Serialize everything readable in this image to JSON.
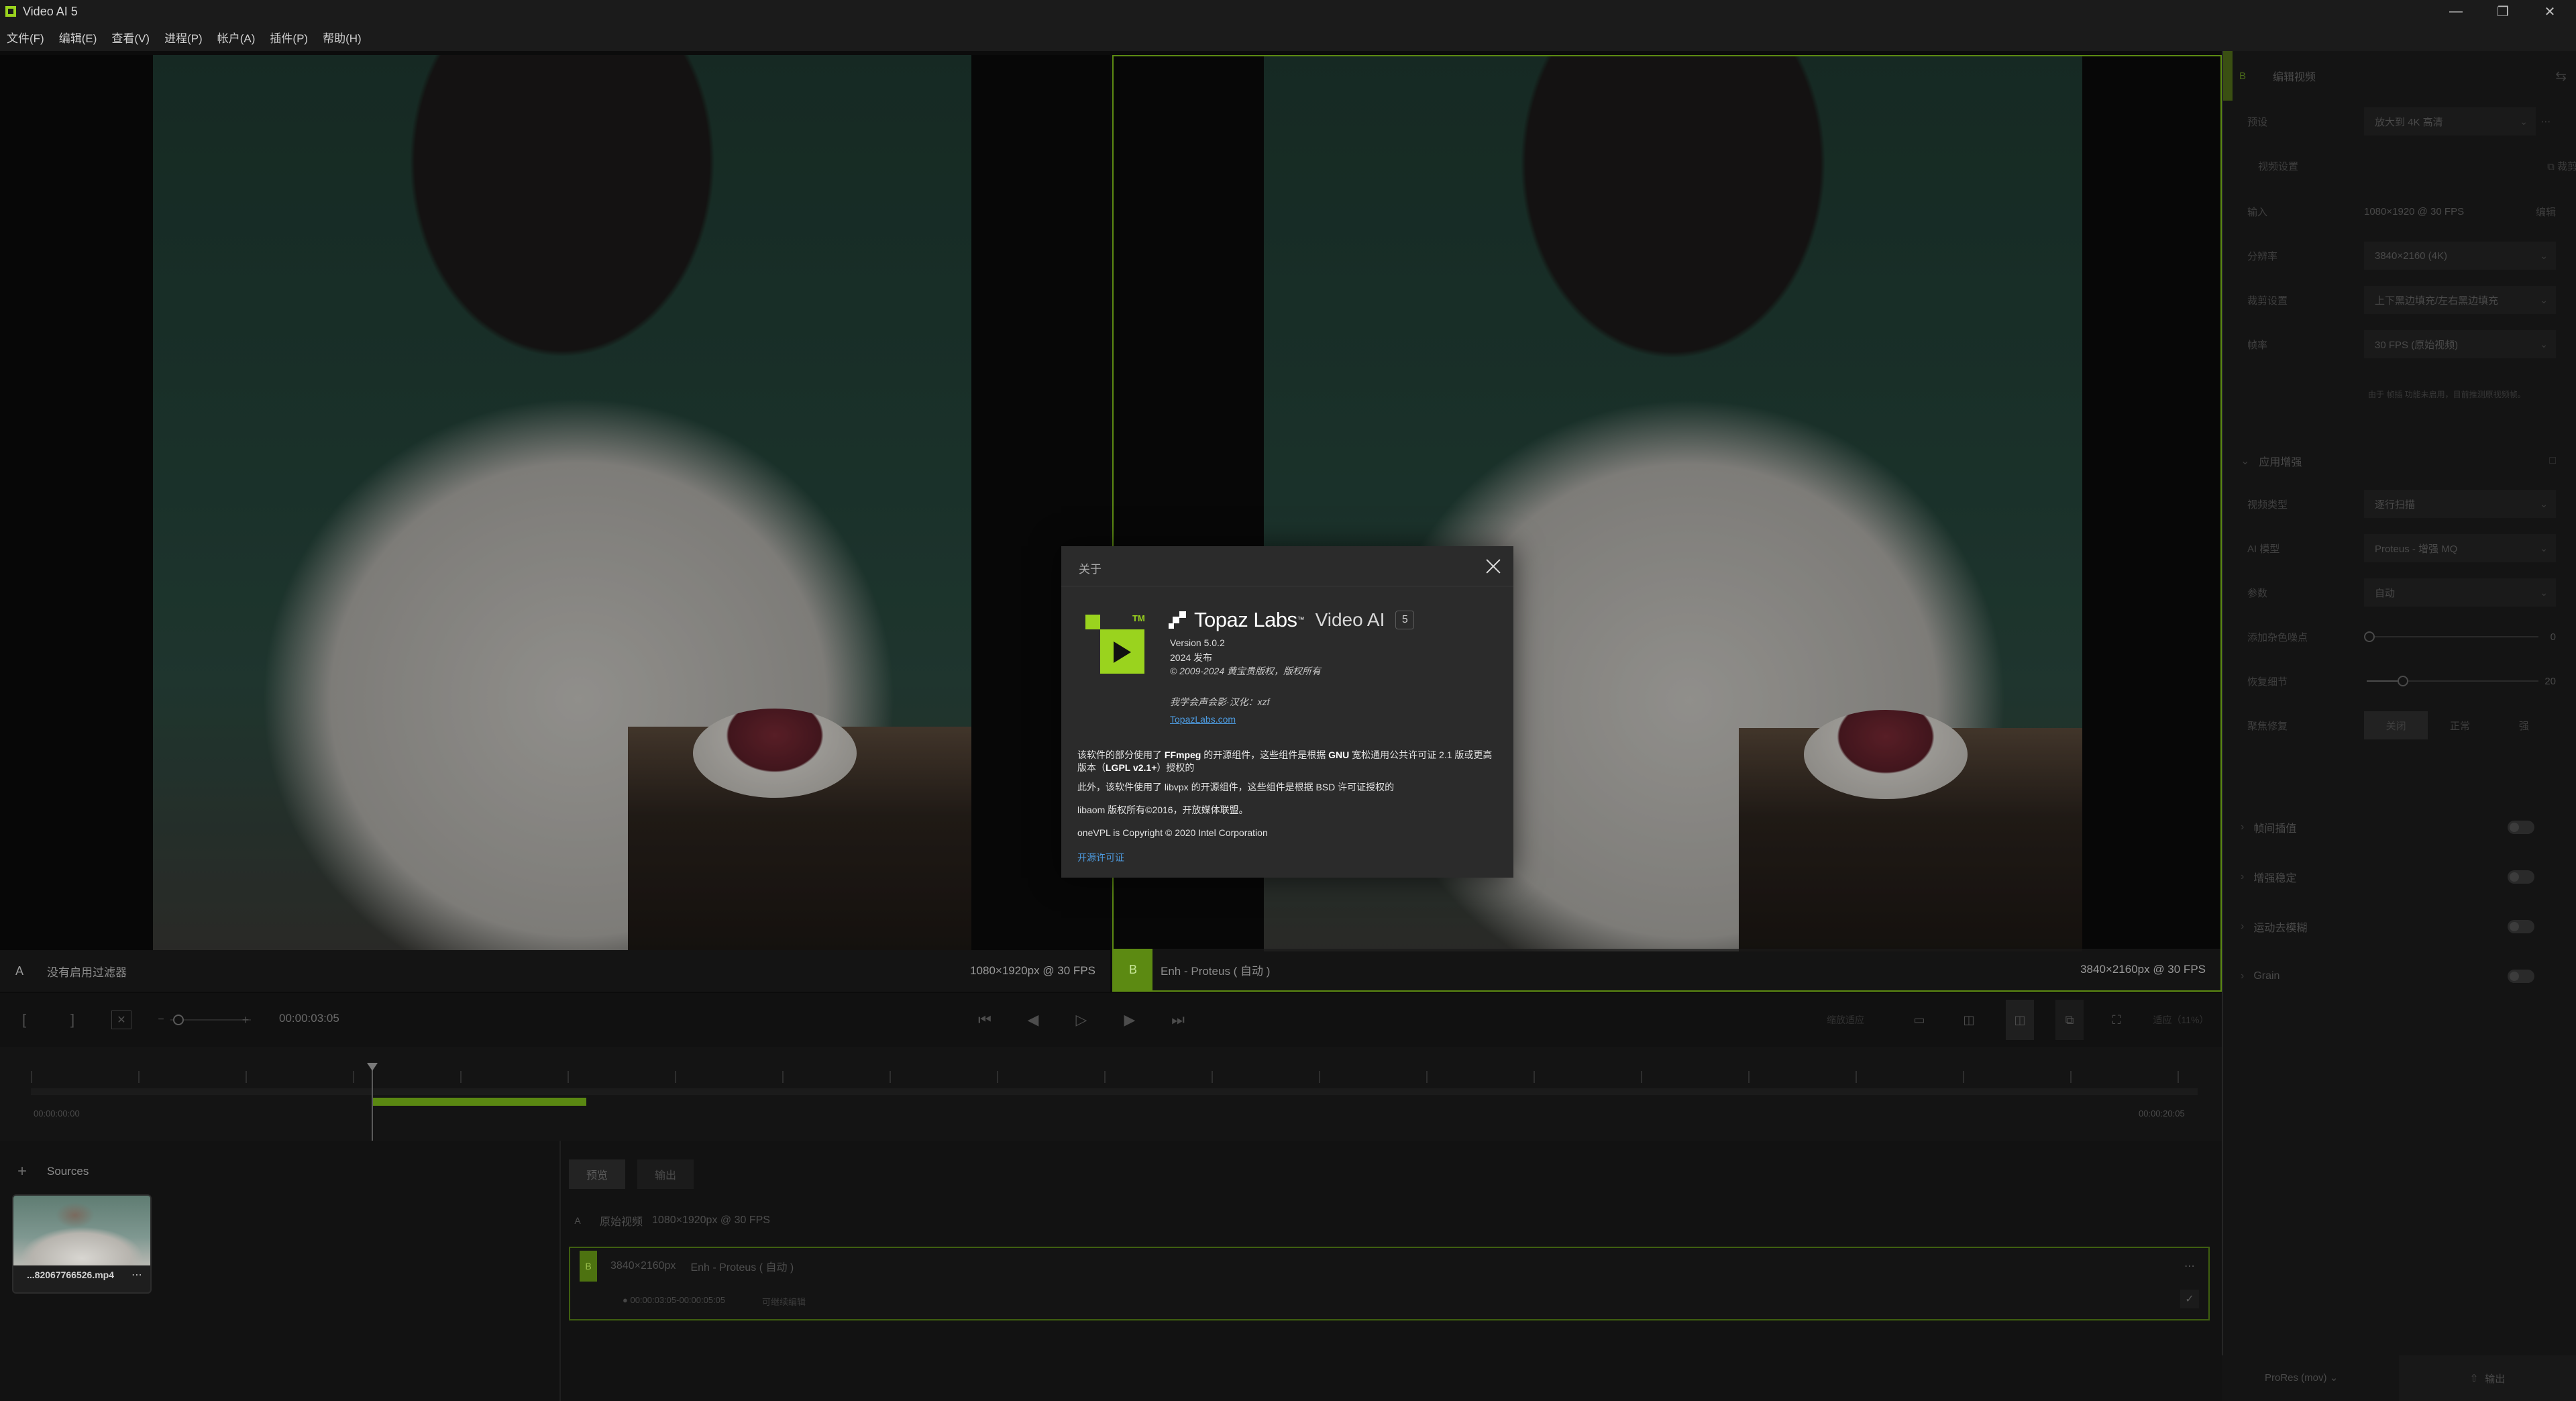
{
  "window": {
    "title": "Video AI 5"
  },
  "menu": [
    "文件(F)",
    "编辑(E)",
    "查看(V)",
    "进程(P)",
    "帐户(A)",
    "插件(P)",
    "帮助(H)"
  ],
  "preview": {
    "a": {
      "letter": "A",
      "label": "没有启用过滤器",
      "resolution": "1080×1920px @ 30 FPS"
    },
    "b": {
      "letter": "B",
      "label": "Enh - Proteus ( 自动 )",
      "resolution": "3840×2160px @ 30 FPS"
    }
  },
  "about": {
    "title": "关于",
    "brand": "Topaz Labs",
    "product": "Video AI",
    "version_badge": "5",
    "version": "Version 5.0.2",
    "release": "2024 发布",
    "copyright": "© 2009-2024 黄宝贵版权，版权所有",
    "localizer": "我学会声会影·汉化：xzf",
    "website": "TopazLabs.com",
    "notice_ffmpeg_pre": "该软件的部分使用了",
    "notice_ffmpeg_bold": "FFmpeg",
    "notice_ffmpeg_mid": "的开源组件，这些组件是根据",
    "notice_ffmpeg_gnu": "GNU",
    "notice_ffmpeg_post": "宽松通用公共许可证 2.1 版或更高版本（",
    "notice_ffmpeg_lgpl": "LGPL v2.1+",
    "notice_ffmpeg_end": "）授权的",
    "notice_libvpx": "此外，该软件使用了 libvpx 的开源组件，这些组件是根据 BSD 许可证授权的",
    "notice_libaom": "libaom 版权所有©2016，开放媒体联盟。",
    "notice_onevpl": "oneVPL is Copyright © 2020 Intel Corporation",
    "oss_link": "开源许可证"
  },
  "right_panel": {
    "header_letter": "B",
    "header_title": "编辑视频",
    "preset_label": "预设",
    "preset_value": "放大到 4K 高清",
    "video_settings": "视频设置",
    "crop_label": "裁剪",
    "input_label": "输入",
    "input_value": "1080×1920 @ 30 FPS",
    "input_edit": "编辑",
    "resolution_label": "分辨率",
    "resolution_value": "3840×2160 (4K)",
    "crop_setting_label": "裁剪设置",
    "crop_setting_value": "上下黑边填充/左右黑边填充",
    "fps_label": "帧率",
    "fps_value": "30 FPS (原始视频)",
    "note": "由于 帧插 功能未启用，目前推测原视频帧。",
    "enhance_section": "应用增强",
    "video_type_label": "视频类型",
    "video_type_value": "逐行扫描",
    "ai_model_label": "AI 模型",
    "ai_model_value": "Proteus - 增强 MQ",
    "params_label": "参数",
    "params_value": "自动",
    "noise_label": "添加杂色噪点",
    "noise_value": "0",
    "detail_label": "恢复细节",
    "detail_value": "20",
    "focus_label": "聚焦修复",
    "focus_opts": [
      "关闭",
      "正常",
      "强"
    ],
    "frame_interp": "帧间插值",
    "stabilize": "增强稳定",
    "motion_deblur": "运动去模糊",
    "grain": "Grain",
    "export_format": "ProRes (mov)",
    "export_button": "输出"
  },
  "controls": {
    "in_mark": "[",
    "out_mark": "]",
    "time": "00:00:03:05",
    "zoom": "适应（11%）",
    "view_zoom": "缩放适应"
  },
  "timeline": {
    "start": "00:00:00:00",
    "end": "00:00:20:05"
  },
  "sources": {
    "title": "Sources",
    "file": "...82067766526.mp4"
  },
  "exports": {
    "tab_preview": "预览",
    "tab_export": "输出",
    "row_a_letter": "A",
    "row_a_label": "原始视频",
    "row_a_res": "1080×1920px @ 30 FPS",
    "row_b_letter": "B",
    "row_b_res": "3840×2160px",
    "row_b_model": "Enh - Proteus ( 自动 )",
    "row_b_range": "● 00:00:03:05-00:00:05:05",
    "row_b_status": "可继续编辑"
  }
}
